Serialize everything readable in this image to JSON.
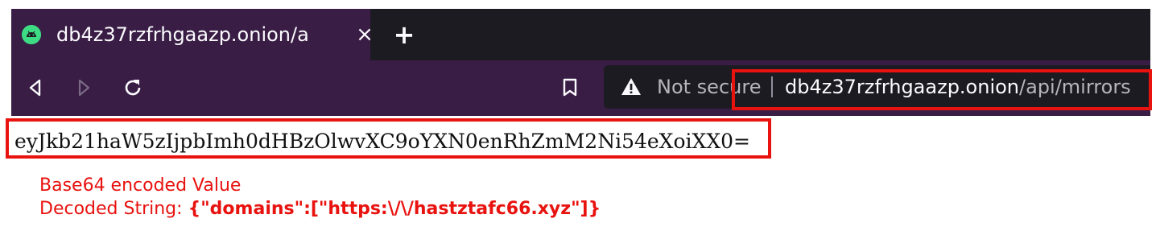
{
  "browser": {
    "tab_title": "db4z37rzfrhgaazp.onion/a",
    "tab_close": "×",
    "new_tab": "+",
    "security_label": "Not secure",
    "url_host": "db4z37rzfrhgaazp.onion",
    "url_path": "/api/mirrors"
  },
  "page": {
    "response_body": "eyJkb21haW5zIjpbImh0dHBzOlwvXC9oYXN0enRhZmM2Ni54eXoiXX0="
  },
  "annotation": {
    "line1": "Base64 encoded Value",
    "line2_label": "Decoded String: ",
    "line2_value": "{\"domains\":[\"https:\\/\\/hastztafc66.xyz\"]}"
  },
  "colors": {
    "highlight": "#e8120f",
    "tab_bg": "#3a1d45",
    "urlbar_bg": "#1c1b22",
    "favicon": "#3ddc84"
  },
  "icons": [
    "android-favicon-icon",
    "close-icon",
    "plus-icon",
    "back-icon",
    "forward-icon",
    "reload-icon",
    "bookmark-icon",
    "warning-icon"
  ]
}
